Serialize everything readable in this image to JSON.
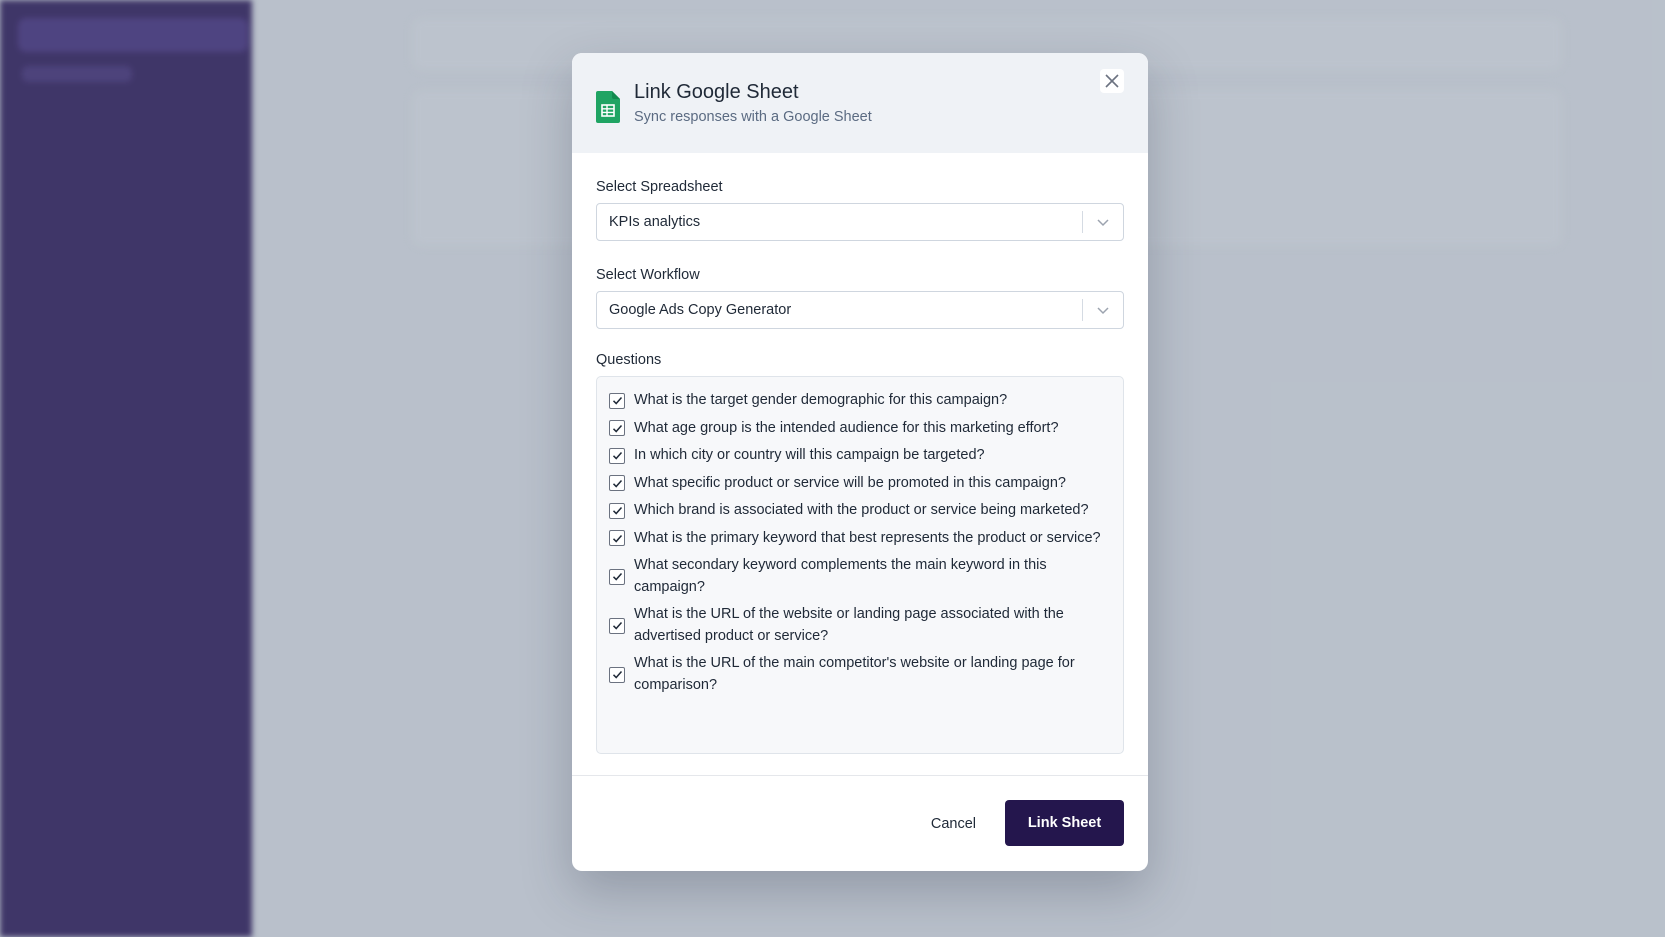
{
  "modal": {
    "title": "Link Google Sheet",
    "subtitle": "Sync responses with a Google Sheet",
    "spreadsheet_label": "Select Spreadsheet",
    "spreadsheet_value": "KPIs analytics",
    "workflow_label": "Select Workflow",
    "workflow_value": "Google Ads Copy Generator",
    "questions_label": "Questions",
    "questions": [
      "What is the target gender demographic for this campaign?",
      "What age group is the intended audience for this marketing effort?",
      "In which city or country will this campaign be targeted?",
      "What specific product or service will be promoted in this campaign?",
      "Which brand is associated with the product or service being marketed?",
      "What is the primary keyword that best represents the product or service?",
      "What secondary keyword complements the main keyword in this campaign?",
      "What is the URL of the website or landing page associated with the advertised product or service?",
      "What is the URL of the main competitor's website or landing page for comparison?"
    ],
    "cancel_label": "Cancel",
    "submit_label": "Link Sheet"
  },
  "colors": {
    "primary": "#24164d",
    "sidebar": "#3b2f66",
    "sheets_green": "#1fa463"
  },
  "icons": {
    "header": "google-sheets-icon",
    "close": "close-icon",
    "dropdown": "chevron-down-icon",
    "checkbox": "check-icon"
  }
}
